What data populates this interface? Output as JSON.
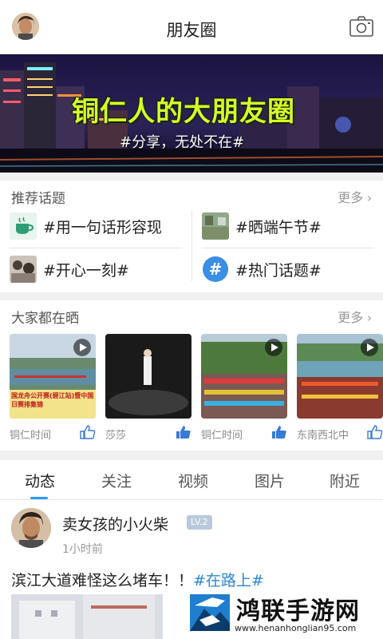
{
  "header": {
    "title": "朋友圈",
    "left_icon": "avatar",
    "right_icon": "camera-icon"
  },
  "banner": {
    "title": "铜仁人的大朋友圈",
    "subtitle": "#分享，无处不在#"
  },
  "recommended": {
    "title": "推荐话题",
    "more": "更多",
    "topics": [
      {
        "label": "#用一句话形容现",
        "icon": "coffee-icon"
      },
      {
        "label": "#晒端午节#",
        "icon": "photo-thumb"
      },
      {
        "label": "#开心一刻#",
        "icon": "photo-thumb"
      },
      {
        "label": "#热门话题#",
        "icon": "hashtag-icon"
      }
    ]
  },
  "everyone": {
    "title": "大家都在晒",
    "more": "更多",
    "cards": [
      {
        "name": "铜仁时间",
        "caption": "国龙舟公开赛(碧江站)暨中国\n日赛排集锦"
      },
      {
        "name": "莎莎"
      },
      {
        "name": "铜仁时间"
      },
      {
        "name": "东南西北中"
      }
    ]
  },
  "tabs": [
    "动态",
    "关注",
    "视频",
    "图片",
    "附近"
  ],
  "post": {
    "user": "卖女孩的小火柴",
    "level": "LV.2",
    "time": "1小时前",
    "text": "滨江大道难怪这么堵车！！",
    "tag": "#在路上#"
  },
  "watermark": {
    "title": "鸿联手游网",
    "url": "www.henanhonglian95.com"
  },
  "colors": {
    "accent": "#2b9af3",
    "tag": "#2b86d6",
    "banner_title": "#d7ff2a"
  }
}
